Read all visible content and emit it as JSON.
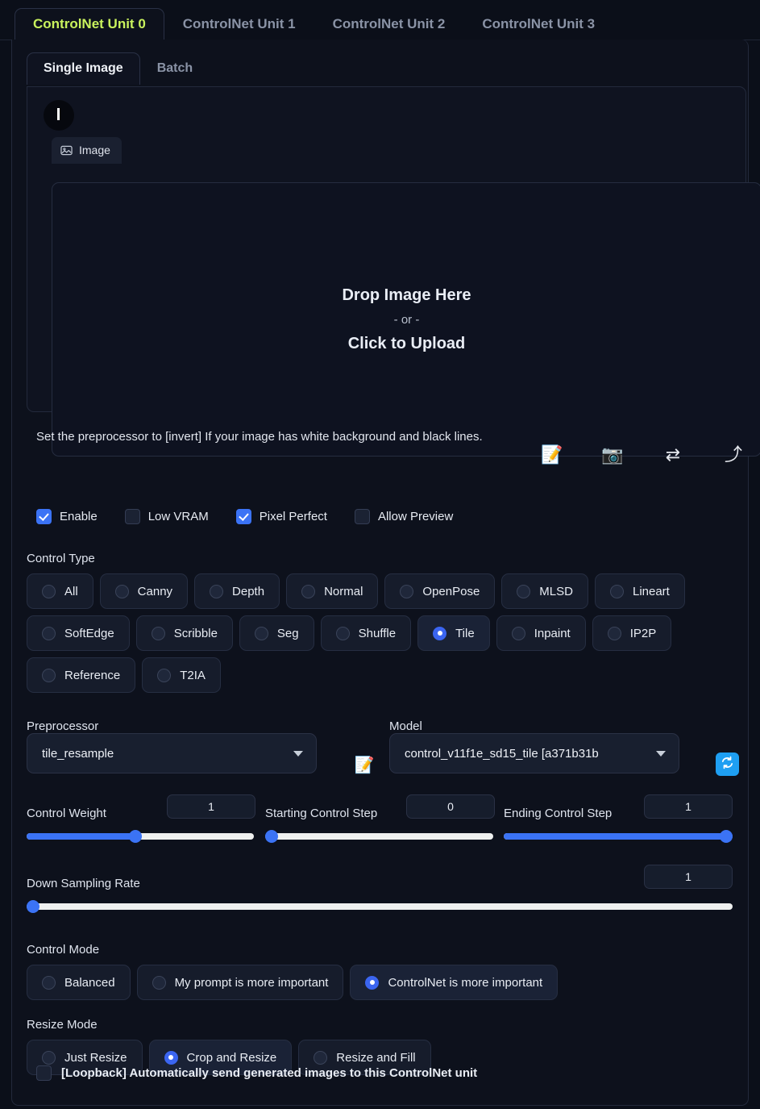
{
  "unit_tabs": [
    {
      "label": "ControlNet Unit 0",
      "active": true
    },
    {
      "label": "ControlNet Unit 1",
      "active": false
    },
    {
      "label": "ControlNet Unit 2",
      "active": false
    },
    {
      "label": "ControlNet Unit 3",
      "active": false
    }
  ],
  "sub_tabs": [
    {
      "label": "Single Image",
      "active": true
    },
    {
      "label": "Batch",
      "active": false
    }
  ],
  "image_chip": {
    "label": "Image",
    "icon": "image-icon"
  },
  "drop_area": {
    "primary": "Drop Image Here",
    "separator": "- or -",
    "secondary": "Click to Upload"
  },
  "hint": "Set the preprocessor to [invert] If your image has white background and black lines.",
  "emoji_tools": [
    {
      "name": "edit-prompt-icon",
      "glyph": "📝"
    },
    {
      "name": "camera-icon",
      "glyph": "📷"
    },
    {
      "name": "swap-icon",
      "glyph": "⇄"
    },
    {
      "name": "send-icon",
      "glyph": "⤴"
    }
  ],
  "checkboxes": [
    {
      "label": "Enable",
      "checked": true
    },
    {
      "label": "Low VRAM",
      "checked": false
    },
    {
      "label": "Pixel Perfect",
      "checked": true
    },
    {
      "label": "Allow Preview",
      "checked": false
    }
  ],
  "control_type": {
    "label": "Control Type",
    "selected": "Tile",
    "options": [
      "All",
      "Canny",
      "Depth",
      "Normal",
      "OpenPose",
      "MLSD",
      "Lineart",
      "SoftEdge",
      "Scribble",
      "Seg",
      "Shuffle",
      "Tile",
      "Inpaint",
      "IP2P",
      "Reference",
      "T2IA"
    ]
  },
  "preprocessor": {
    "label": "Preprocessor",
    "value": "tile_resample"
  },
  "model": {
    "label": "Model",
    "value": "control_v11f1e_sd15_tile [a371b31b"
  },
  "refresh_button": {
    "name": "refresh-models-button",
    "icon": "refresh-icon"
  },
  "sliders": [
    {
      "label": "Control Weight",
      "value": "1",
      "percent": 48
    },
    {
      "label": "Starting Control Step",
      "value": "0",
      "percent": 0
    },
    {
      "label": "Ending Control Step",
      "value": "1",
      "percent": 100
    },
    {
      "label": "Down Sampling Rate",
      "value": "1",
      "percent": 0
    }
  ],
  "control_mode": {
    "label": "Control Mode",
    "selected": "ControlNet is more important",
    "options": [
      "Balanced",
      "My prompt is more important",
      "ControlNet is more important"
    ]
  },
  "resize_mode": {
    "label": "Resize Mode",
    "selected": "Crop and Resize",
    "options": [
      "Just Resize",
      "Crop and Resize",
      "Resize and Fill"
    ]
  },
  "loopback": {
    "label": "[Loopback] Automatically send generated images to this ControlNet unit",
    "checked": false
  },
  "colors": {
    "active_tab": "#c9f25d",
    "accent_blue": "#3b73f5",
    "radio_blue": "#3b65f0",
    "refresh_blue": "#1e9ff2",
    "page_bg": "#0b0f19",
    "panel_bg": "#0d111c"
  }
}
